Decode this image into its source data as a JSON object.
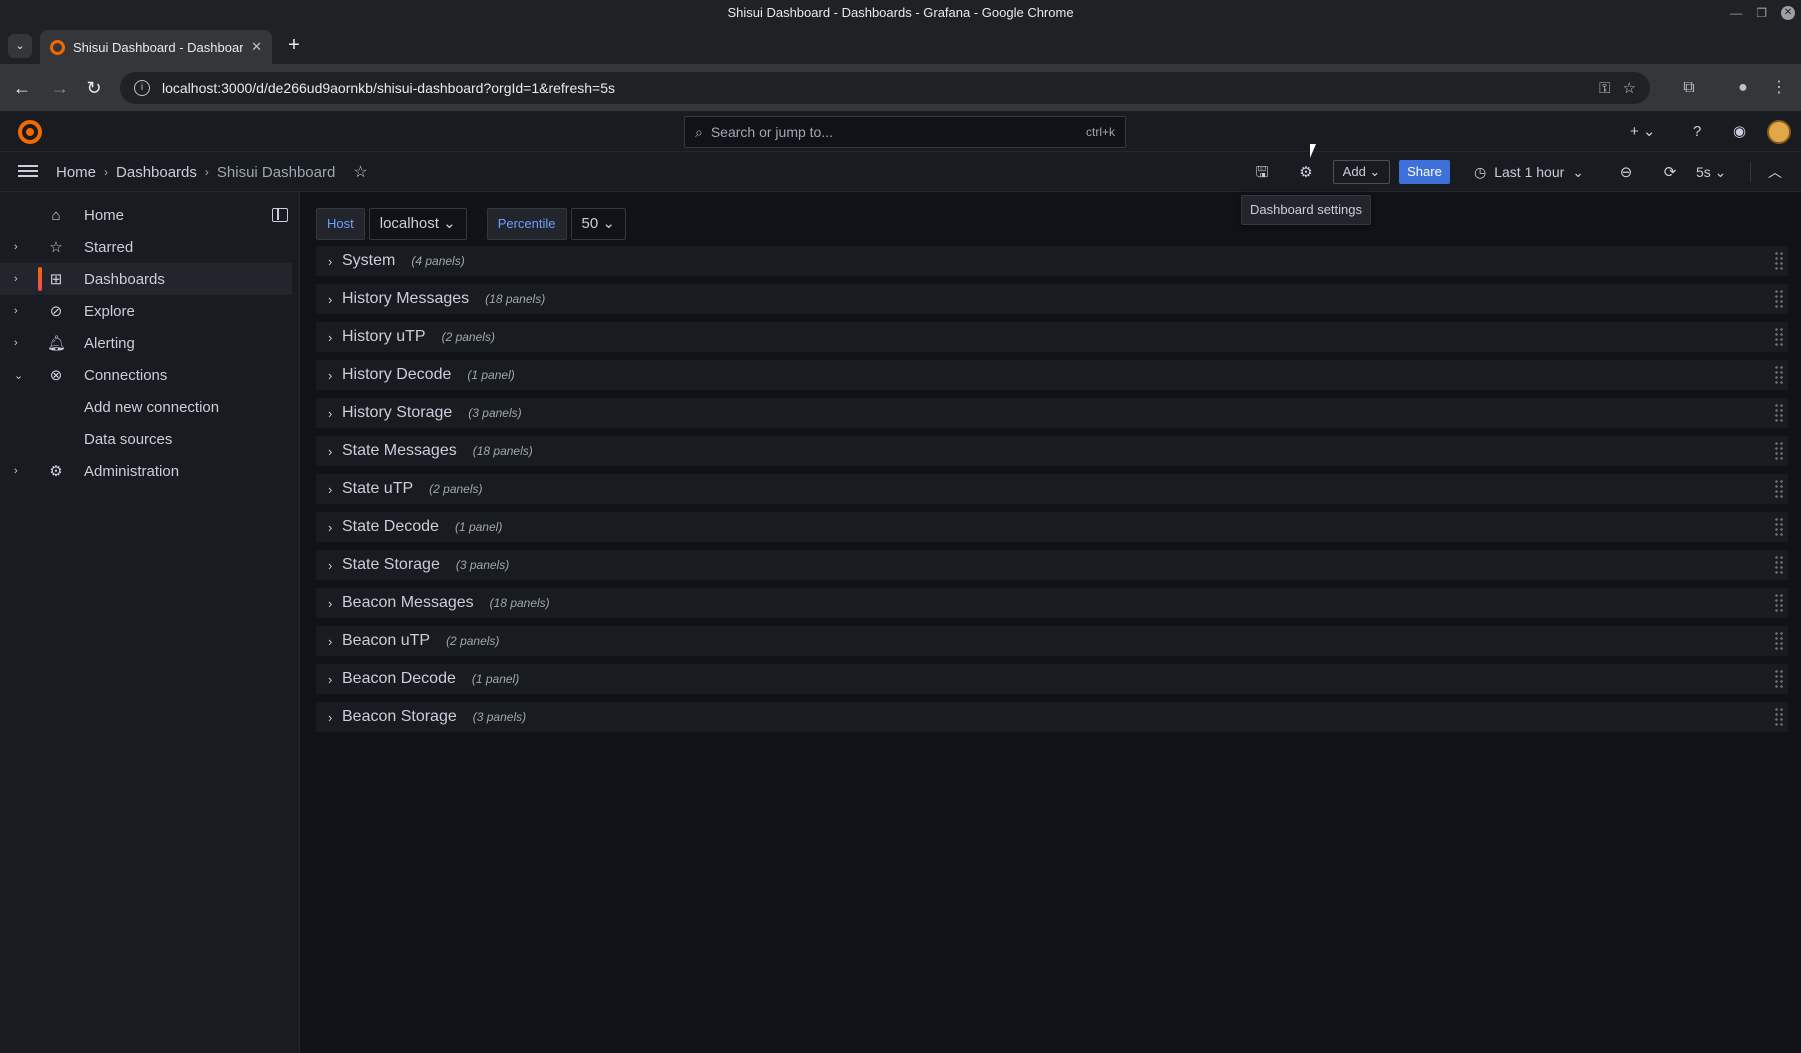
{
  "browser": {
    "window_title": "Shisui Dashboard - Dashboards - Grafana - Google Chrome",
    "tab_title": "Shisui Dashboard - Dashboar",
    "url": "localhost:3000/d/de266ud9aornkb/shisui-dashboard?orgId=1&refresh=5s"
  },
  "topnav": {
    "search_placeholder": "Search or jump to...",
    "search_shortcut": "ctrl+k",
    "new_label": "+"
  },
  "breadcrumbs": [
    {
      "label": "Home"
    },
    {
      "label": "Dashboards"
    },
    {
      "label": "Shisui Dashboard"
    }
  ],
  "dashboard_toolbar": {
    "add_label": "Add",
    "share_label": "Share",
    "time_range": "Last 1 hour",
    "refresh_interval": "5s",
    "tooltip": "Dashboard settings"
  },
  "sidebar": {
    "items": [
      {
        "label": "Home",
        "icon": "home-icon",
        "chevron": ""
      },
      {
        "label": "Starred",
        "icon": "star-icon",
        "chevron": "›"
      },
      {
        "label": "Dashboards",
        "icon": "grid-icon",
        "chevron": "›",
        "active": true
      },
      {
        "label": "Explore",
        "icon": "compass-icon",
        "chevron": "›"
      },
      {
        "label": "Alerting",
        "icon": "bell-icon",
        "chevron": "›"
      },
      {
        "label": "Connections",
        "icon": "link-icon",
        "chevron": "⌄"
      },
      {
        "label": "Add new connection",
        "icon": "",
        "chevron": ""
      },
      {
        "label": "Data sources",
        "icon": "",
        "chevron": ""
      },
      {
        "label": "Administration",
        "icon": "gear-icon",
        "chevron": "›"
      }
    ]
  },
  "variables": {
    "host_label": "Host",
    "host_value": "localhost",
    "percentile_label": "Percentile",
    "percentile_value": "50"
  },
  "rows": [
    {
      "title": "System",
      "count": "(4 panels)"
    },
    {
      "title": "History Messages",
      "count": "(18 panels)"
    },
    {
      "title": "History uTP",
      "count": "(2 panels)"
    },
    {
      "title": "History Decode",
      "count": "(1 panel)"
    },
    {
      "title": "History Storage",
      "count": "(3 panels)"
    },
    {
      "title": "State Messages",
      "count": "(18 panels)"
    },
    {
      "title": "State uTP",
      "count": "(2 panels)"
    },
    {
      "title": "State Decode",
      "count": "(1 panel)"
    },
    {
      "title": "State Storage",
      "count": "(3 panels)"
    },
    {
      "title": "Beacon Messages",
      "count": "(18 panels)"
    },
    {
      "title": "Beacon uTP",
      "count": "(2 panels)"
    },
    {
      "title": "Beacon Decode",
      "count": "(1 panel)"
    },
    {
      "title": "Beacon Storage",
      "count": "(3 panels)"
    }
  ],
  "colors": {
    "accent": "#f46800",
    "primary": "#3d71d9",
    "background": "#111217",
    "panel": "#181b1f"
  }
}
